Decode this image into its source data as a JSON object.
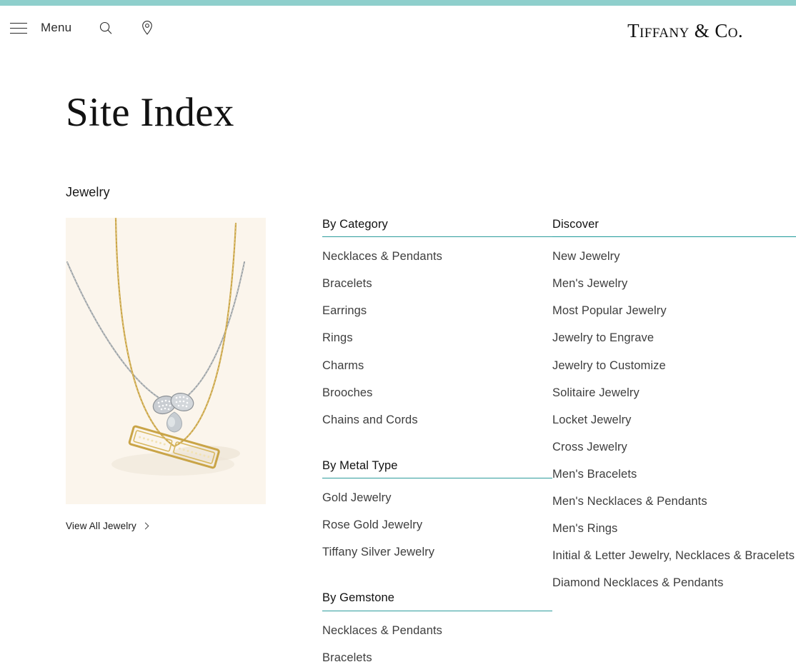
{
  "theme": {
    "accent_teal": "#8ECFCC",
    "rule_teal": "#2E9C9C",
    "text_dark": "#1a1a1a",
    "link_gray": "#3e3e3e",
    "image_bg": "#FBF5EC"
  },
  "header": {
    "menu_label": "Menu",
    "hamburger_icon": "hamburger-icon",
    "search_icon": "search-icon",
    "location_icon": "location-pin-icon",
    "brand": "Tiffany & Co."
  },
  "page": {
    "title": "Site Index",
    "section_label": "Jewelry"
  },
  "promo": {
    "image_alt": "layered gold bar and silver diamond bow necklaces",
    "view_all_label": "View All Jewelry",
    "chevron_icon": "chevron-right-icon"
  },
  "columns": [
    {
      "groups": [
        {
          "heading": "By Category",
          "items": [
            "Necklaces & Pendants",
            "Bracelets",
            "Earrings",
            "Rings",
            "Charms",
            "Brooches",
            "Chains and Cords"
          ]
        },
        {
          "heading": "By Metal Type",
          "items": [
            "Gold Jewelry",
            "Rose Gold Jewelry",
            "Tiffany Silver Jewelry"
          ]
        },
        {
          "heading": "By Gemstone",
          "items": [
            "Necklaces & Pendants",
            "Bracelets"
          ]
        }
      ]
    },
    {
      "groups": [
        {
          "heading": "Discover",
          "items": [
            "New Jewelry",
            "Men's Jewelry",
            "Most Popular Jewelry",
            "Jewelry to Engrave",
            "Jewelry to Customize",
            "Solitaire Jewelry",
            "Locket Jewelry",
            "Cross Jewelry",
            "Men's Bracelets",
            "Men's Necklaces & Pendants",
            "Men's Rings",
            "Initial & Letter Jewelry, Necklaces & Bracelets",
            "Diamond Necklaces & Pendants"
          ]
        }
      ]
    }
  ]
}
